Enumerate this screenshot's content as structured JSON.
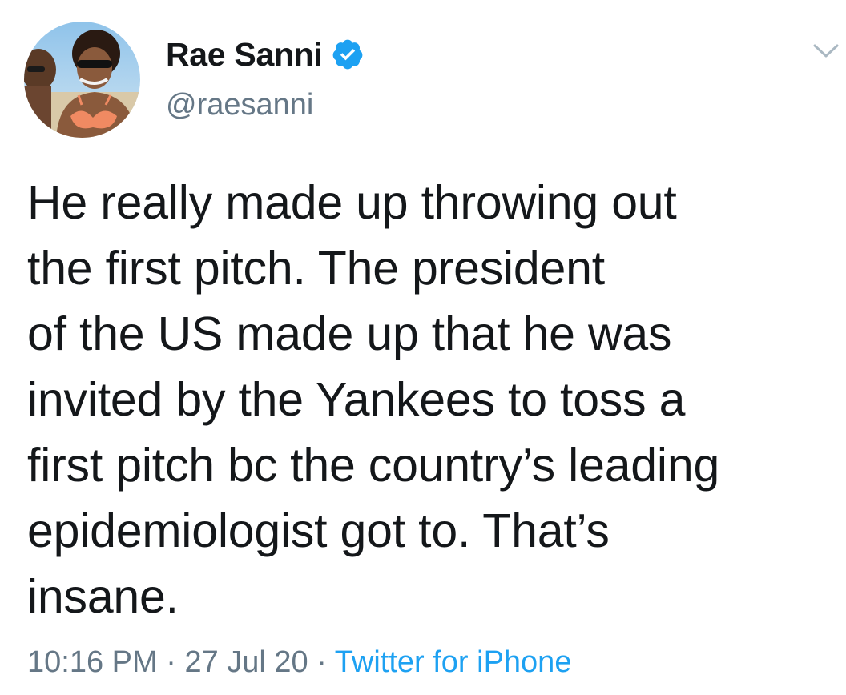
{
  "author": {
    "display_name": "Rae Sanni",
    "handle": "@raesanni",
    "verified_icon": "verified-badge-icon",
    "avatar_icon": "profile-photo"
  },
  "menu": {
    "icon": "chevron-down-icon"
  },
  "tweet": {
    "lines": [
      "He really made up throwing out",
      "the first pitch. The president",
      "of the US made up that he was",
      "invited by the Yankees to toss a",
      "first pitch bc the country’s leading",
      "epidemiologist got to. That’s",
      "insane."
    ]
  },
  "meta": {
    "time": "10:16 PM",
    "separator": " · ",
    "date": "27 Jul 20",
    "source": "Twitter for iPhone"
  },
  "colors": {
    "text": "#14171a",
    "secondary": "#657786",
    "link": "#1da1f2",
    "verified": "#1da1f2"
  }
}
